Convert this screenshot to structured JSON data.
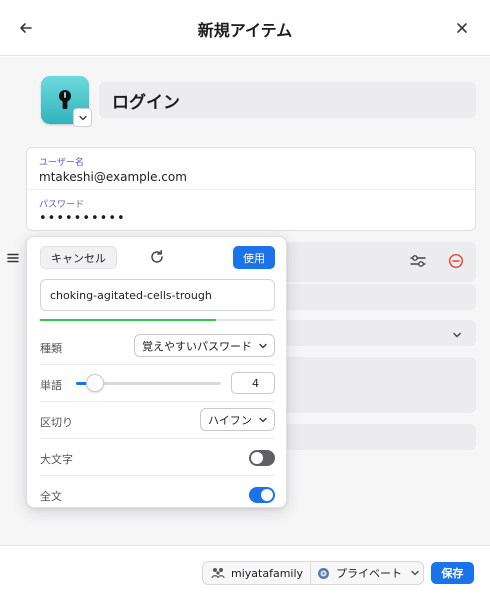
{
  "header": {
    "title": "新規アイテム",
    "back_icon": "arrow-left-icon",
    "close_icon": "close-icon"
  },
  "item": {
    "icon": "login-keyhole-icon",
    "title": "ログイン"
  },
  "login": {
    "username_label": "ユーザー名",
    "username_value": "mtakeshi@example.com",
    "password_label": "パスワード",
    "password_value": "••••••••••"
  },
  "generator": {
    "cancel_label": "キャンセル",
    "use_label": "使用",
    "refresh_icon": "refresh-icon",
    "generated_password": "choking-agitated-cells-trough",
    "strength": 0.75,
    "type_label": "種類",
    "type_value": "覚えやすいパスワード",
    "words_label": "単語",
    "words_value": "4",
    "words_slider": 0.13,
    "separator_label": "区切り",
    "separator_value": "ハイフン",
    "uppercase_label": "大文字",
    "uppercase_on": false,
    "fullword_label": "全文",
    "fullword_on": true
  },
  "footer": {
    "account": "miyatafamily",
    "vault": "プライベート",
    "save_label": "保存"
  },
  "colors": {
    "accent": "#1a73e8",
    "label_purple": "#5c58d6",
    "strength_green": "#34c759",
    "remove_red": "#e0452c"
  }
}
